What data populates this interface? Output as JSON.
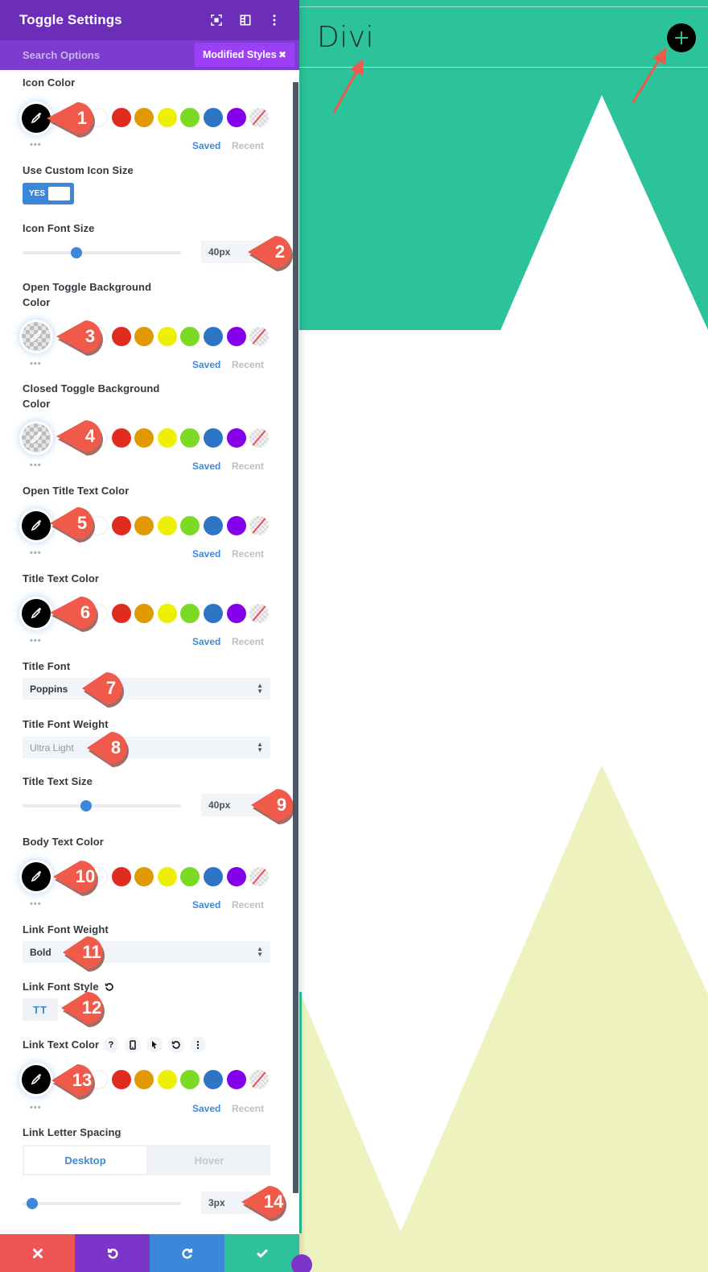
{
  "panel": {
    "title": "Toggle Settings",
    "header_icons": [
      "focus-icon",
      "split-view-icon",
      "more-vertical-icon"
    ],
    "search_placeholder": "Search Options",
    "filter_chip": {
      "label": "Modified Styles",
      "close_icon": "close-icon"
    }
  },
  "palette": {
    "swatches": [
      "#ffffff",
      "#e02b20",
      "#e09900",
      "#edf000",
      "#7cda24",
      "#2f75c6",
      "#8300e9",
      "none"
    ],
    "saved_label": "Saved",
    "recent_label": "Recent",
    "more_label": "•••"
  },
  "fields": {
    "icon_color": {
      "label": "Icon Color",
      "value": "#000000",
      "callout": "1"
    },
    "custom_icon_size": {
      "label": "Use Custom Icon Size",
      "value": "YES"
    },
    "icon_font_size": {
      "label": "Icon Font Size",
      "value": "40px",
      "slider_fraction": 0.34,
      "callout": "2"
    },
    "open_bg": {
      "label_line1": "Open Toggle Background",
      "label_line2": "Color",
      "value": "transparent",
      "callout": "3"
    },
    "closed_bg": {
      "label_line1": "Closed Toggle Background",
      "label_line2": "Color",
      "value": "transparent",
      "callout": "4"
    },
    "open_title_color": {
      "label": "Open Title Text Color",
      "value": "#000000",
      "callout": "5"
    },
    "title_color": {
      "label": "Title Text Color",
      "value": "#000000",
      "callout": "6"
    },
    "title_font": {
      "label": "Title Font",
      "value": "Poppins",
      "callout": "7"
    },
    "title_font_weight": {
      "label": "Title Font Weight",
      "value": "Ultra Light",
      "callout": "8"
    },
    "title_text_size": {
      "label": "Title Text Size",
      "value": "40px",
      "slider_fraction": 0.4,
      "callout": "9"
    },
    "body_text_color": {
      "label": "Body Text Color",
      "value": "#000000",
      "callout": "10"
    },
    "link_font_weight": {
      "label": "Link Font Weight",
      "value": "Bold",
      "callout": "11"
    },
    "link_font_style": {
      "label": "Link Font Style",
      "value": "TT",
      "callout": "12"
    },
    "link_text_color": {
      "label": "Link Text Color",
      "value": "#000000",
      "callout": "13",
      "tools": [
        "help-icon",
        "responsive-icon",
        "hover-cursor-icon",
        "reset-icon",
        "more-vertical-icon"
      ]
    },
    "link_letter_spacing": {
      "label": "Link Letter Spacing",
      "tabs": [
        "Desktop",
        "Hover"
      ],
      "active_tab": "Desktop",
      "value": "3px",
      "slider_fraction": 0.06,
      "callout": "14"
    }
  },
  "help_glyph": "?",
  "footer": {
    "buttons": [
      {
        "name": "discard",
        "color": "#ef5555"
      },
      {
        "name": "undo",
        "color": "#7b35c9"
      },
      {
        "name": "redo",
        "color": "#3b87d9"
      },
      {
        "name": "save",
        "color": "#2fc29a"
      }
    ]
  },
  "canvas": {
    "title": "Divi",
    "accent": "#2cc39a",
    "lower_shape_color": "#eef2bf",
    "toggle_icon": "plus-icon"
  },
  "colors": {
    "header_purple": "#6c2eb9",
    "subbar_purple": "#7e3bd0",
    "chip_purple": "#9b40f5",
    "callout_red": "#ef5a4b",
    "link_blue": "#3e8ad8"
  }
}
